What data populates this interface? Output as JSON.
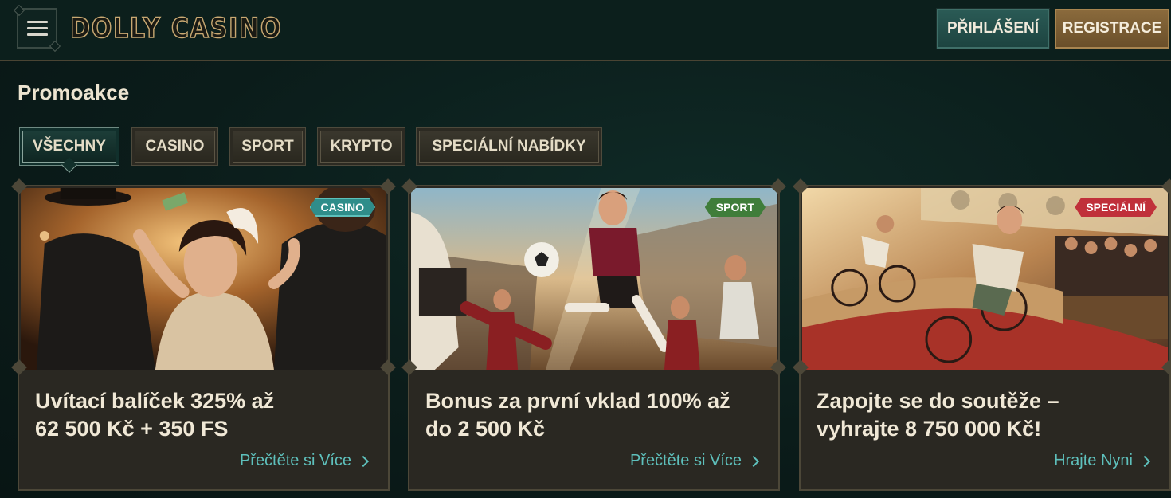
{
  "header": {
    "logo": "DOLLY CASINO",
    "login_label": "PŘIHLÁŠENÍ",
    "register_label": "REGISTRACE",
    "colors": {
      "login": "#2a5a55",
      "register": "#8a6a3c",
      "accent": "#c9a972"
    }
  },
  "page": {
    "title": "Promoakce"
  },
  "tabs": [
    {
      "label": "VŠECHNY",
      "active": true
    },
    {
      "label": "CASINO",
      "active": false
    },
    {
      "label": "SPORT",
      "active": false
    },
    {
      "label": "KRYPTO",
      "active": false
    },
    {
      "label": "SPECIÁLNÍ NABÍDKY",
      "active": false
    }
  ],
  "cards": [
    {
      "badge": "CASINO",
      "badge_color": "#2f8d8a",
      "title_line1": "Uvítací balíček 325% až",
      "title_line2": "62 500 Kč + 350 FS",
      "link": "Přečtěte si Více",
      "image": "flapper-woman-casino-illustration"
    },
    {
      "badge": "SPORT",
      "badge_color": "#3f7d3a",
      "title_line1": "Bonus za první vklad 100% až",
      "title_line2": "do 2 500 Kč",
      "link": "Přečtěte si Více",
      "image": "vintage-football-illustration"
    },
    {
      "badge": "SPECIÁLNÍ",
      "badge_color": "#c0303a",
      "title_line1": "Zapojte se do soutěže –",
      "title_line2": "vyhrajte 8 750 000 Kč!",
      "link": "Hrajte Nyni",
      "image": "vintage-cycling-race-illustration"
    }
  ]
}
